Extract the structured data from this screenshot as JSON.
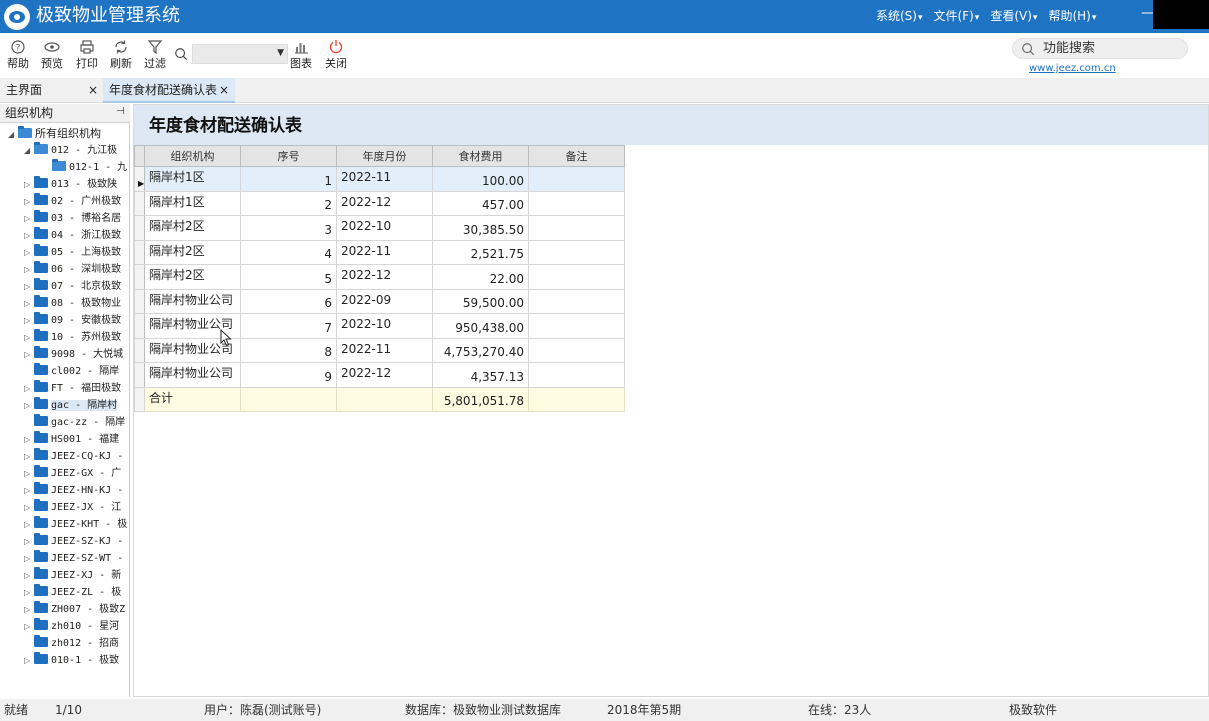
{
  "app": {
    "title": "极致物业管理系统"
  },
  "menus": [
    "系统(S)",
    "文件(F)",
    "查看(V)",
    "帮助(H)"
  ],
  "toolbar": {
    "help": "帮助",
    "preview": "预览",
    "print": "打印",
    "refresh": "刷新",
    "filter": "过滤",
    "search_value": "",
    "chart": "图表",
    "close": "关闭"
  },
  "func_search": {
    "label": "功能搜索"
  },
  "site_link": "www.jeez.com.cn",
  "tabs": [
    {
      "label": "主界面",
      "close": "×"
    },
    {
      "label": "年度食材配送确认表",
      "close": "×"
    }
  ],
  "left_panel": {
    "title": "组织机构",
    "pin": "ᵖ",
    "root": "所有组织机构",
    "nodes": [
      "012 - 九江极",
      "012-1 - 九",
      "013 - 极致陕",
      "02 - 广州极致",
      "03 - 博裕名居",
      "04 - 浙江极致",
      "05 - 上海极致",
      "06 - 深圳极致",
      "07 - 北京极致",
      "08 - 极致物业",
      "09 - 安徽极致",
      "10 - 苏州极致",
      "9098 - 大悦城",
      "cl002 - 隔岸",
      "FT - 福田极致",
      "gac - 隔岸村",
      "gac-zz - 隔岸",
      "HS001 - 福建",
      "JEEZ-CQ-KJ -",
      "JEEZ-GX - 广",
      "JEEZ-HN-KJ -",
      "JEEZ-JX - 江",
      "JEEZ-KHT - 极",
      "JEEZ-SZ-KJ -",
      "JEEZ-SZ-WT -",
      "JEEZ-XJ - 新",
      "JEEZ-ZL - 极",
      "ZH007 - 极致Z",
      "zh010 - 星河",
      "zh012 - 招商",
      "010-1 - 极致"
    ]
  },
  "report": {
    "title": "年度食材配送确认表",
    "columns": [
      "组织机构",
      "序号",
      "年度月份",
      "食材费用",
      "备注"
    ],
    "rows": [
      [
        "隔岸村1区",
        "1",
        "2022-11",
        "100.00",
        ""
      ],
      [
        "隔岸村1区",
        "2",
        "2022-12",
        "457.00",
        ""
      ],
      [
        "隔岸村2区",
        "3",
        "2022-10",
        "30,385.50",
        ""
      ],
      [
        "隔岸村2区",
        "4",
        "2022-11",
        "2,521.75",
        ""
      ],
      [
        "隔岸村2区",
        "5",
        "2022-12",
        "22.00",
        ""
      ],
      [
        "隔岸村物业公司",
        "6",
        "2022-09",
        "59,500.00",
        ""
      ],
      [
        "隔岸村物业公司",
        "7",
        "2022-10",
        "950,438.00",
        ""
      ],
      [
        "隔岸村物业公司",
        "8",
        "2022-11",
        "4,753,270.40",
        ""
      ],
      [
        "隔岸村物业公司",
        "9",
        "2022-12",
        "4,357.13",
        ""
      ]
    ],
    "total": [
      "合计",
      "",
      "",
      "5,801,051.78",
      ""
    ]
  },
  "status": {
    "state": "就绪",
    "page": "1/10",
    "user": "用户：陈磊(测试账号)",
    "database": "数据库：极致物业测试数据库",
    "period": "2018年第5期",
    "online": "在线：23人",
    "vendor": "极致软件"
  }
}
